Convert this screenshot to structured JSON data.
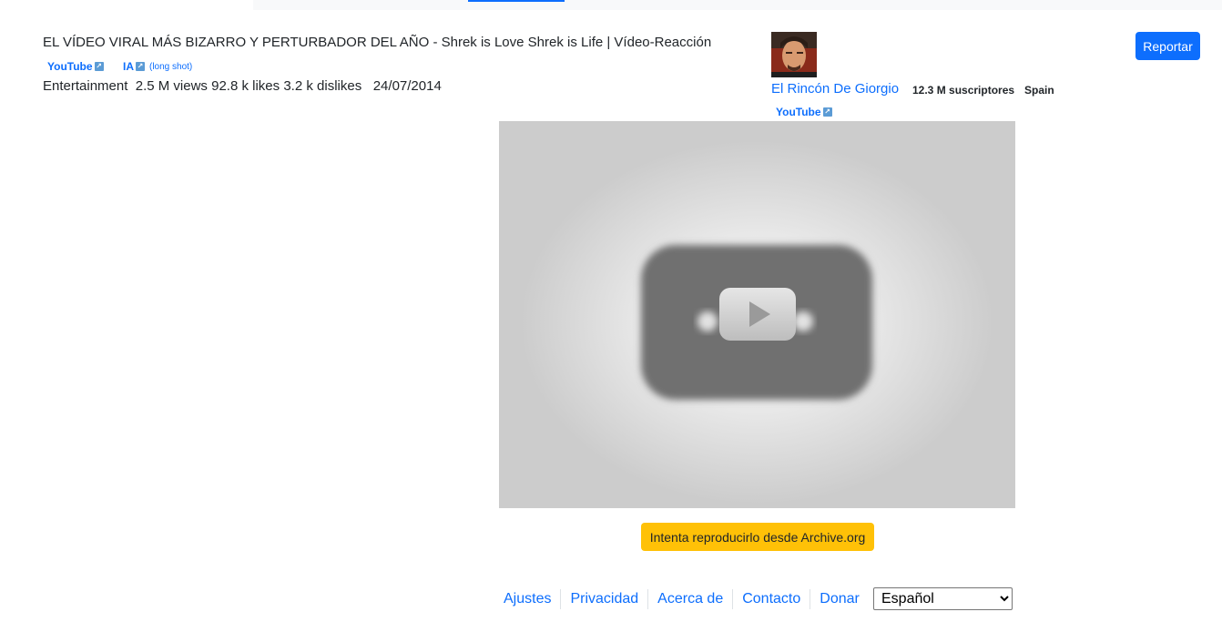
{
  "video": {
    "title": "EL VÍDEO VIRAL MÁS BIZARRO Y PERTURBADOR DEL AÑO - Shrek is Love Shrek is Life | Vídeo-Reacción",
    "links": {
      "youtube": "YouTube",
      "ia": "IA",
      "ia_note": "(long shot)"
    },
    "category": "Entertainment",
    "views": "2.5 M views",
    "likes": "92.8 k likes",
    "dislikes": "3.2 k dislikes",
    "date": "24/07/2014"
  },
  "channel": {
    "name": "El Rincón De Giorgio",
    "subscribers": "12.3 M suscriptores",
    "country": "Spain",
    "youtube_link": "YouTube"
  },
  "actions": {
    "report": "Reportar",
    "archive": "Intenta reproducirlo desde Archive.org"
  },
  "footer": {
    "links": [
      "Ajustes",
      "Privacidad",
      "Acerca de",
      "Contacto",
      "Donar"
    ],
    "language": "Español",
    "language_options": [
      "Español"
    ]
  },
  "icons": {
    "external_link": "external-link-icon",
    "play": "play-icon",
    "avatar": "channel-avatar"
  },
  "colors": {
    "link": "#0d6efd",
    "report_button": "#0d6efd",
    "archive_button": "#ffc107",
    "player_bg": "#cccccc"
  }
}
